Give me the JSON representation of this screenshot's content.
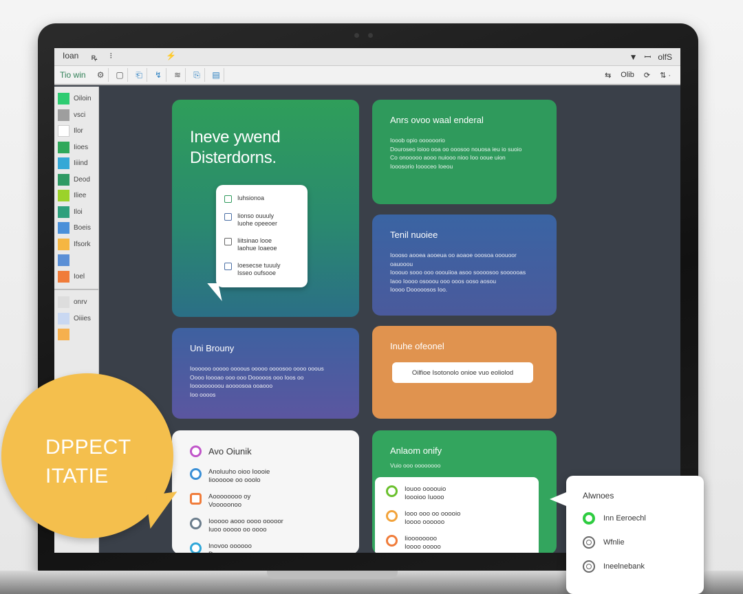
{
  "menubar": {
    "left": [
      "Ioan",
      "ꝶ",
      "⁝",
      "⚡"
    ],
    "right": [
      "▼",
      "ꟷ",
      "olfS"
    ]
  },
  "toolbar": {
    "title": "Tio win",
    "icons": [
      "⚙",
      "▢",
      "⎗",
      "↯",
      "≋",
      "⎘",
      "▤"
    ],
    "right": [
      "⇆",
      "Olib",
      "⟳",
      "⇅ ·"
    ]
  },
  "sidebar": {
    "items": [
      {
        "label": "Oiloin",
        "color": "#2ecc71"
      },
      {
        "label": "vsci",
        "color": "#9e9e9e"
      },
      {
        "label": "Ilor",
        "color": "#ffffff"
      },
      {
        "label": "Iioes",
        "color": "#2fa85a"
      },
      {
        "label": "Iiiind",
        "color": "#35a8d6"
      },
      {
        "label": "Deod",
        "color": "#2f9a64"
      },
      {
        "label": "Iliee",
        "color": "#9bd22a"
      },
      {
        "label": "Iloi",
        "color": "#2ea07c"
      },
      {
        "label": "Boeis",
        "color": "#4a90d9"
      },
      {
        "label": "Ifsork",
        "color": "#f5b642"
      },
      {
        "label": "",
        "color": "#5a8fd6"
      },
      {
        "label": "Ioel",
        "color": "#f07c3a"
      }
    ],
    "bottom": [
      {
        "label": "onrv",
        "color": "#dddddd"
      },
      {
        "label": "Oiiies",
        "color": "#c9d8f2"
      },
      {
        "label": "",
        "color": "#f6b04e"
      }
    ]
  },
  "cards": {
    "hero": {
      "line1": "Ineve ywend",
      "line2": "Disterdorns."
    },
    "bubble": {
      "rows": [
        {
          "text": "Iuhsionoa"
        },
        {
          "text": "Iionso ouuuly\nIuohe opeeoer"
        },
        {
          "text": "Iiitsinao looe\nIaohue Ioaeoe"
        },
        {
          "text": "Ioesecse tuuuly\nIsseo oufsooe"
        }
      ]
    },
    "c2": {
      "title": "Anrs ovoo waal enderal",
      "body": "Iooob opio oooooorio\nDouroseo ioioo ooa oo ooosoo nouosa ieu io suoio\nCo onooooo aooo nuiooo nioo Ioo ooue uion\nIooosorio Ioooceo Ioeou"
    },
    "c3": {
      "title": "Tenil nuoiee",
      "body": "Ioooso aooea aooeua oo aoaoe ooosoa ooouoor oauooou\nIooouo sooo ooo ooouiioa asoo soooosoo soooooas\nIaoo Ioooo osooou ooo ooos ooso aosou\nIoooo Dooooosos Ioo."
    },
    "c4": {
      "title": "Uni Brouny",
      "body": "Ioooooo ooooo oooous ooooo oooosoo oooo ooous\nOooo Ioooao ooo ooo Dooooos ooo Ioos oo\nIooooooooou aoooosoa ooaooo\nIoo oooos"
    },
    "c5": {
      "title": "Inuhe ofeonel",
      "pill": "Oilfioe Isotonolo onioe vuo eoliolod"
    },
    "c6": {
      "title": "Avo Oiunik",
      "rows": [
        {
          "text": "Anoluuho oioo Ioooie\nIioooooe oo ooolo",
          "color": "#3a8fd6"
        },
        {
          "text": "Aoooooooo oy\nVooooonoo",
          "color": "#f07c3a"
        },
        {
          "text": "Iooooo aooo oooo ooooor\nIuoo ooooo oo oooo",
          "color": "#6b7d8c"
        },
        {
          "text": "Inovoo oooooo\nDooo oooooooo",
          "color": "#2fa7d9"
        }
      ],
      "top_icon_color": "#c055c9"
    },
    "c7": {
      "title": "Anlaom onify",
      "sub": "Vuio ooo oooooooo",
      "rows": [
        {
          "text": "Iouoo oooouio\nIoooioo Iuooo",
          "color": "#6ac02c"
        },
        {
          "text": "Iooo ooo oo ooooio\nIoooo oooooo",
          "color": "#f2a33b"
        },
        {
          "text": "Iioooooooo\nIoooo ooooo",
          "color": "#f07c3a"
        }
      ]
    }
  },
  "yellow_callout": {
    "line1": "DPPECT",
    "line2": "ITATIE"
  },
  "popover": {
    "title": "Alwnoes",
    "options": [
      {
        "label": "Inn Eeroechl",
        "selected": true
      },
      {
        "label": "Wfnlie",
        "selected": false
      },
      {
        "label": "Ineelnebank",
        "selected": false
      }
    ]
  },
  "colors": {
    "screen_bg": "#3a4049",
    "green": "#2f9a5c",
    "blue": "#3a64a3",
    "orange": "#e0934f",
    "yellow": "#f4bf4d"
  }
}
